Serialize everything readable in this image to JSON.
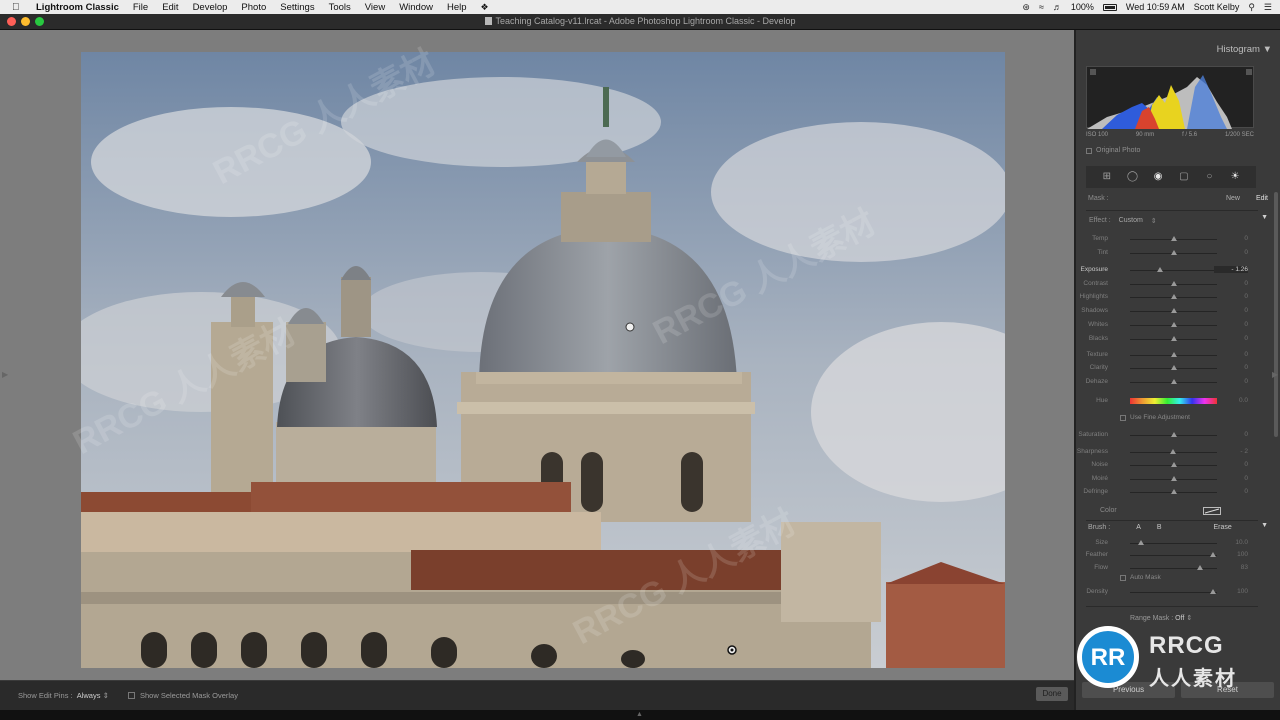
{
  "menubar": {
    "app_name": "Lightroom Classic",
    "items": [
      "File",
      "Edit",
      "Develop",
      "Photo",
      "Settings",
      "Tools",
      "View",
      "Window",
      "Help"
    ],
    "battery": "100%",
    "clock": "Wed 10:59 AM",
    "user": "Scott Kelby"
  },
  "window": {
    "title": "Teaching Catalog-v11.lrcat - Adobe Photoshop Lightroom Classic - Develop"
  },
  "toolbar": {
    "show_edit_pins_label": "Show Edit Pins :",
    "show_edit_pins_value": "Always",
    "show_mask_overlay_label": "Show Selected Mask Overlay",
    "done_label": "Done"
  },
  "panel": {
    "histogram_label": "Histogram",
    "iso": "ISO 100",
    "focal": "90 mm",
    "aperture": "f / 5.6",
    "shutter": "1/200 SEC",
    "original_photo_label": "Original Photo",
    "mask_label": "Mask :",
    "new_label": "New",
    "edit_label": "Edit",
    "effect_label": "Effect :",
    "effect_value": "Custom",
    "sliders_group1": [
      {
        "label": "Temp",
        "value": "0",
        "pos": 0.5
      },
      {
        "label": "Tint",
        "value": "0",
        "pos": 0.5
      }
    ],
    "sliders_group2": [
      {
        "label": "Exposure",
        "value": "- 1.26",
        "pos": 0.35,
        "active": true
      },
      {
        "label": "Contrast",
        "value": "0",
        "pos": 0.5
      },
      {
        "label": "Highlights",
        "value": "0",
        "pos": 0.5
      },
      {
        "label": "Shadows",
        "value": "0",
        "pos": 0.5
      },
      {
        "label": "Whites",
        "value": "0",
        "pos": 0.5
      },
      {
        "label": "Blacks",
        "value": "0",
        "pos": 0.5
      }
    ],
    "sliders_group3": [
      {
        "label": "Texture",
        "value": "0",
        "pos": 0.5
      },
      {
        "label": "Clarity",
        "value": "0",
        "pos": 0.5
      },
      {
        "label": "Dehaze",
        "value": "0",
        "pos": 0.5
      }
    ],
    "hue_label": "Hue",
    "hue_value": "0.0",
    "fine_adjust_label": "Use Fine Adjustment",
    "sliders_group4": [
      {
        "label": "Saturation",
        "value": "0",
        "pos": 0.5
      }
    ],
    "sliders_group5": [
      {
        "label": "Sharpness",
        "value": "- 2",
        "pos": 0.49
      },
      {
        "label": "Noise",
        "value": "0",
        "pos": 0.5
      },
      {
        "label": "Moiré",
        "value": "0",
        "pos": 0.5
      },
      {
        "label": "Defringe",
        "value": "0",
        "pos": 0.5
      }
    ],
    "color_label": "Color",
    "brush_label": "Brush :",
    "brush_a": "A",
    "brush_b": "B",
    "erase_label": "Erase",
    "sliders_brush": [
      {
        "label": "Size",
        "value": "10.0",
        "pos": 0.13
      },
      {
        "label": "Feather",
        "value": "100",
        "pos": 0.95
      },
      {
        "label": "Flow",
        "value": "83",
        "pos": 0.8
      }
    ],
    "auto_mask_label": "Auto Mask",
    "sliders_density": [
      {
        "label": "Density",
        "value": "100",
        "pos": 0.95
      }
    ],
    "range_mask_label": "Range Mask :",
    "range_mask_value": "Off",
    "previous_label": "Previous",
    "reset_label": "Reset"
  },
  "watermark": {
    "logo_letters": "RR",
    "brand": "RRCG",
    "brand_cn": "人人素材",
    "overlay_text": "RRCG 人人素材"
  }
}
